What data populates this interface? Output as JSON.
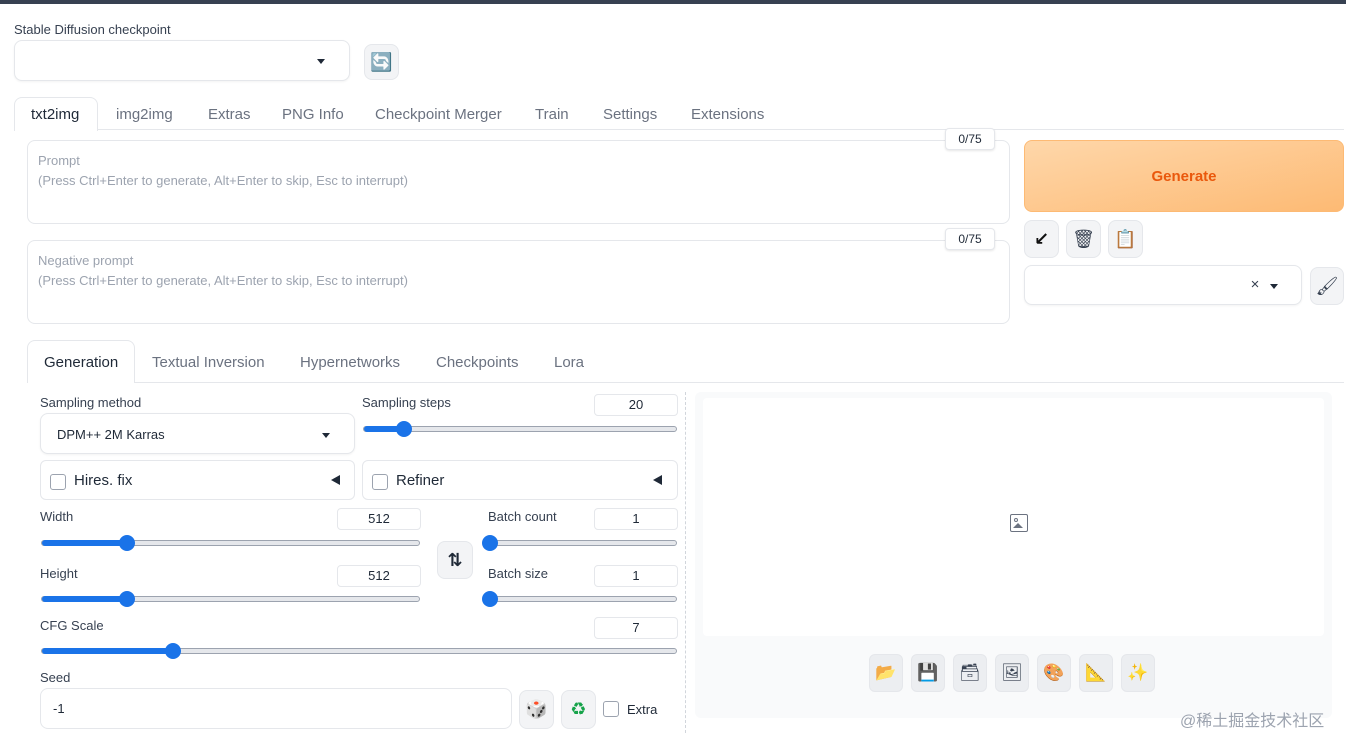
{
  "checkpoint": {
    "label": "Stable Diffusion checkpoint",
    "value": ""
  },
  "main_tabs": [
    "txt2img",
    "img2img",
    "Extras",
    "PNG Info",
    "Checkpoint Merger",
    "Train",
    "Settings",
    "Extensions"
  ],
  "prompt": {
    "label": "Prompt",
    "placeholder": "(Press Ctrl+Enter to generate, Alt+Enter to skip, Esc to interrupt)",
    "token_count": "0/75"
  },
  "negative_prompt": {
    "label": "Negative prompt",
    "placeholder": "(Press Ctrl+Enter to generate, Alt+Enter to skip, Esc to interrupt)",
    "token_count": "0/75"
  },
  "generate": {
    "label": "Generate"
  },
  "styles": {
    "clear_symbol": "×"
  },
  "sub_tabs": [
    "Generation",
    "Textual Inversion",
    "Hypernetworks",
    "Checkpoints",
    "Lora"
  ],
  "sampling_method": {
    "label": "Sampling method",
    "value": "DPM++ 2M Karras"
  },
  "sampling_steps": {
    "label": "Sampling steps",
    "value": "20",
    "min": 1,
    "max": 150
  },
  "hires_fix": {
    "label": "Hires. fix",
    "checked": false
  },
  "refiner": {
    "label": "Refiner",
    "checked": false
  },
  "width": {
    "label": "Width",
    "value": "512",
    "min": 64,
    "max": 2048
  },
  "height": {
    "label": "Height",
    "value": "512",
    "min": 64,
    "max": 2048
  },
  "batch_count": {
    "label": "Batch count",
    "value": "1",
    "min": 1,
    "max": 100
  },
  "batch_size": {
    "label": "Batch size",
    "value": "1",
    "min": 1,
    "max": 8
  },
  "cfg_scale": {
    "label": "CFG Scale",
    "value": "7",
    "min": 1,
    "max": 30
  },
  "seed": {
    "label": "Seed",
    "value": "-1",
    "extra_label": "Extra"
  },
  "icons": {
    "refresh": "🔄",
    "paste": "↙",
    "trash": "🗑",
    "clipboard": "📋",
    "brush": "🖌",
    "swap": "⇅",
    "dice": "🎲",
    "recycle": "♻",
    "image": "🖼",
    "folder": "📂",
    "save": "💾",
    "zip": "🗃",
    "send_img2img": "🖼",
    "send_inpaint": "🎨",
    "send_extras": "📐",
    "sparkle": "✨"
  },
  "watermark": "@稀土掘金技术社区"
}
